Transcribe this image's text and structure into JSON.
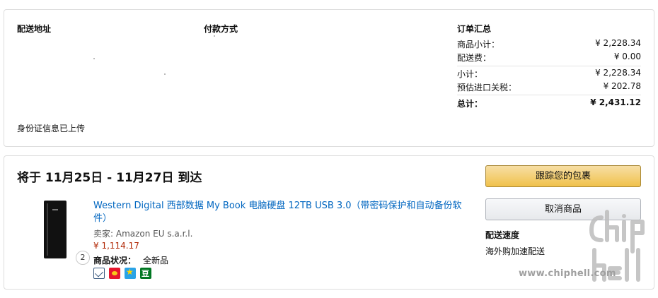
{
  "address": {
    "heading": "配送地址",
    "id_note": "身份证信息已上传"
  },
  "payment": {
    "heading": "付款方式"
  },
  "summary": {
    "heading": "订单汇总",
    "rows": [
      {
        "label": "商品小计：",
        "value": "¥ 2,228.34"
      },
      {
        "label": "配送费：",
        "value": "¥ 0.00"
      },
      {
        "label": "小计：",
        "value": "¥ 2,228.34"
      },
      {
        "label": "预估进口关税：",
        "value": "¥ 202.78"
      }
    ],
    "total": {
      "label": "总计：",
      "value": "¥ 2,431.12"
    }
  },
  "shipment": {
    "title": "将于 11月25日 - 11月27日 到达",
    "item": {
      "name": "Western Digital 西部数据 My Book 电脑硬盘 12TB USB 3.0（带密码保护和自动备份软件）",
      "seller": "卖家: Amazon EU s.a.r.l.",
      "price": "¥ 1,114.17",
      "quantity": "2",
      "condition_label": "商品状况：",
      "condition_value": "全新品"
    },
    "share_icons": [
      "mail-icon",
      "weibo-icon",
      "qzone-icon",
      "douban-icon"
    ],
    "buttons": {
      "track": "跟踪您的包裹",
      "cancel": "取消商品"
    },
    "delivery_speed": {
      "label": "配送速度",
      "value": "海外购加速配送"
    }
  },
  "watermark": {
    "text": "www.chiphell.com",
    "logo": "chip hell"
  },
  "colors": {
    "link": "#0066c0",
    "price": "#b12704",
    "button_primary": "#f0c14b",
    "button_secondary": "#e7e9ec",
    "border": "#dddddd"
  }
}
